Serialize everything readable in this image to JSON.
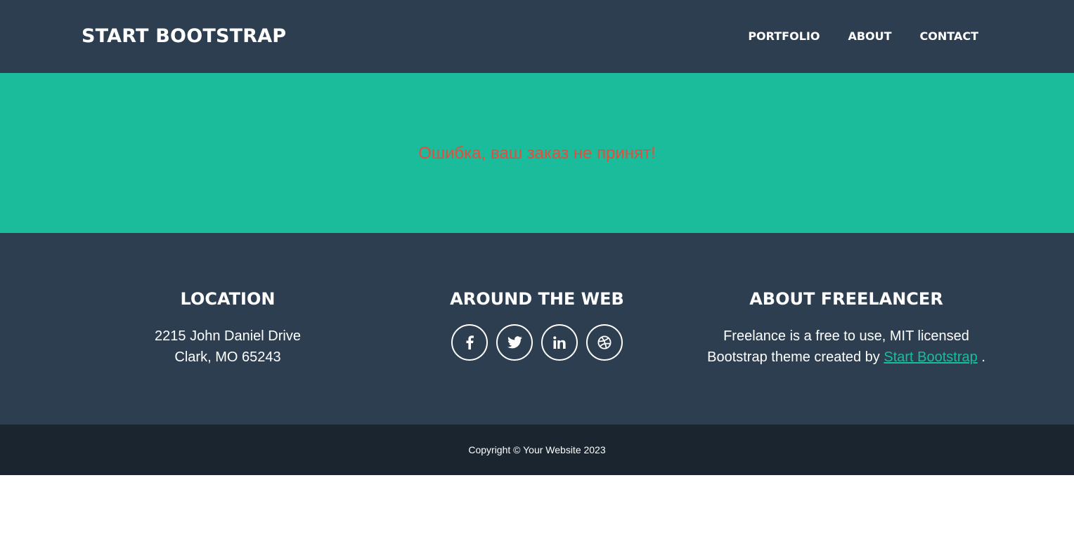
{
  "navbar": {
    "brand": "START BOOTSTRAP",
    "links": [
      "PORTFOLIO",
      "ABOUT",
      "CONTACT"
    ]
  },
  "hero": {
    "message": "Ошибка, ваш заказ не принят!"
  },
  "footer": {
    "location": {
      "title": "LOCATION",
      "line1": "2215 John Daniel Drive",
      "line2": "Clark, MO 65243"
    },
    "web": {
      "title": "AROUND THE WEB",
      "icons": [
        "facebook-icon",
        "twitter-icon",
        "linkedin-icon",
        "dribbble-icon"
      ]
    },
    "about": {
      "title": "ABOUT FREELANCER",
      "text_before": "Freelance is a free to use, MIT licensed Bootstrap theme created by ",
      "link": "Start Bootstrap",
      "text_after": " ."
    }
  },
  "copyright": "Copyright © Your Website 2023",
  "colors": {
    "primary": "#2c3e50",
    "accent": "#1abc9c",
    "error": "#e74c3c",
    "dark": "#1a252f"
  }
}
